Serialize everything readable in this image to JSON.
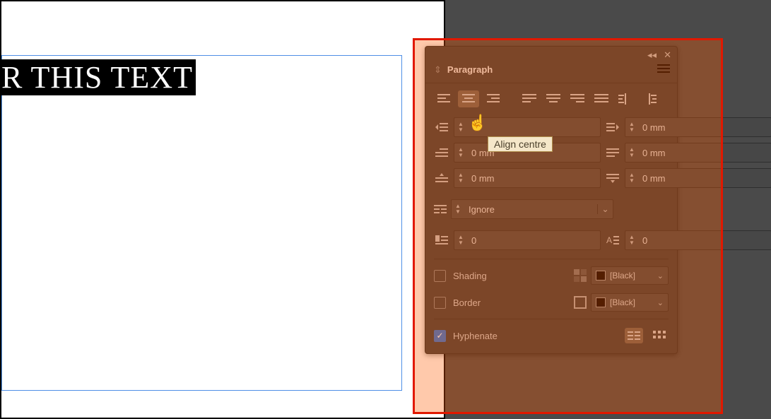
{
  "canvas": {
    "document_text": "R THIS TEXT"
  },
  "panel": {
    "title": "Paragraph",
    "tooltip": "Align centre",
    "alignments": [
      {
        "name": "align-left",
        "active": false
      },
      {
        "name": "align-center",
        "active": true
      },
      {
        "name": "align-right",
        "active": false
      },
      {
        "name": "justify-last-left",
        "active": false
      },
      {
        "name": "justify-last-center",
        "active": false
      },
      {
        "name": "justify-last-right",
        "active": false
      },
      {
        "name": "justify-full",
        "active": false
      },
      {
        "name": "align-spine",
        "active": false
      },
      {
        "name": "align-away-spine",
        "active": false
      }
    ],
    "indent_row1": {
      "left_label": "",
      "right": "0 mm"
    },
    "indent_row2": {
      "left": "0 mm",
      "right": "0 mm"
    },
    "indent_row3": {
      "left": "0 mm",
      "right": "0 mm"
    },
    "span": "Ignore",
    "dropcap_row": {
      "left": "0",
      "right": "0"
    },
    "shading": {
      "checked": false,
      "label": "Shading",
      "swatch": "[Black]"
    },
    "border": {
      "checked": false,
      "label": "Border",
      "swatch": "[Black]"
    },
    "hyphenate": {
      "checked": true,
      "label": "Hyphenate"
    },
    "view_list": true
  }
}
